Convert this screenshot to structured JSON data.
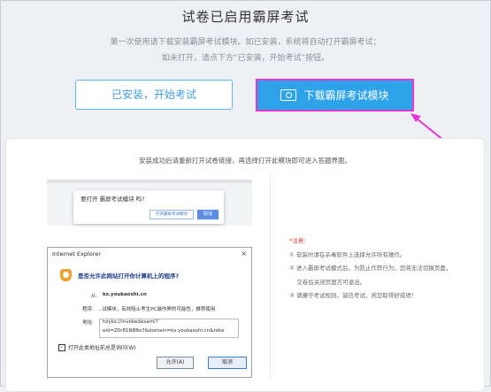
{
  "header": {
    "title": "试卷已启用霸屏考试",
    "line1": "第一次使用请下载安装霸屏考试模块。如已安装，系统将自动打开霸屏考试；",
    "line2": "如未打开，请点下方“已安装，开始考试”按钮。"
  },
  "buttons": {
    "installed": "已安装，开始考试",
    "download": "下载霸屏考试模块"
  },
  "card": {
    "tip": "安装成功后请重新打开试卷链接，再选择打开此模块即可进入答题界面。",
    "browser_dialog": {
      "question": "要打开 霸屏考试模块 吗?",
      "open_label": "打开霸屏考试模块",
      "cancel_label": "取消"
    },
    "ie_dialog": {
      "title": "Internet Explorer",
      "close": "×",
      "question": "是否允许此网站打开你计算机上的程序?",
      "from_label": "从:",
      "from_value": "ks.youkaoshi.cn",
      "program_label": "程序:",
      "program_value": "...试模块，有效阻止考生PC端作弊的可能性，推荐使用",
      "address_label": "地址:",
      "address_line1": "hzyks://invokedexam/?",
      "address_line2": "eid=Z0r81NB8o7&domain=ks.youkaoshi.cn&toke",
      "checkbox_label": "打开此类地址前总是询问(W)",
      "allow_label": "允许(A)",
      "deny_label": "取消"
    },
    "notes": {
      "heading": "*注意:",
      "items": [
        "① 安装时请在杀毒软件上选择允许所有操作。",
        "② 进入霸屏考试模式后，为防止作弊行为，您将无法切换页面，",
        "    交卷后关闭页面方可退出。",
        "③ 请遵守考试规则，诚信考试，祝您取得好成绩！"
      ]
    }
  },
  "colors": {
    "accent": "#2fa3ea",
    "highlight": "#e836d5",
    "warning": "#e23a3a"
  }
}
